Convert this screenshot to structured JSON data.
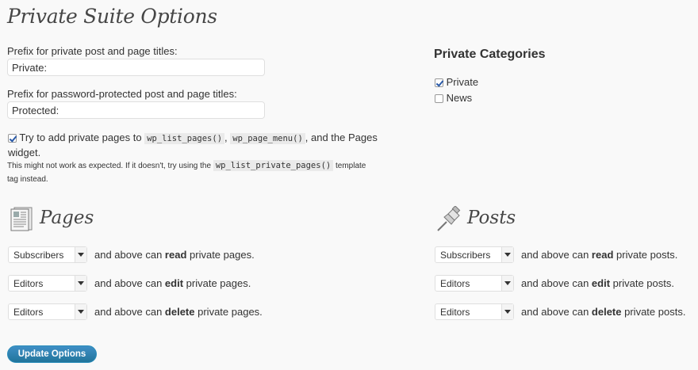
{
  "page_title": "Private Suite Options",
  "private_prefix": {
    "label": "Prefix for private post and page titles:",
    "value": "Private:"
  },
  "protected_prefix": {
    "label": "Prefix for password-protected post and page titles:",
    "value": "Protected:"
  },
  "list_pages_option": {
    "checked": true,
    "text_before": "Try to add private pages to",
    "code1": "wp_list_pages()",
    "comma": ",",
    "code2": "wp_page_menu()",
    "text_after": ", and the Pages",
    "text_line2": "widget.",
    "note_before": "This might not work as expected. If it doesn't, try using the",
    "note_code": "wp_list_private_pages()",
    "note_after": "template",
    "note_line2": "tag instead."
  },
  "private_categories": {
    "title": "Private Categories",
    "items": [
      {
        "label": "Private",
        "checked": true
      },
      {
        "label": "News",
        "checked": false
      }
    ]
  },
  "pages_section": {
    "title": "Pages",
    "rows": [
      {
        "role": "Subscribers",
        "prefix": "and above can",
        "action": "read",
        "suffix": "private pages."
      },
      {
        "role": "Editors",
        "prefix": "and above can",
        "action": "edit",
        "suffix": "private pages."
      },
      {
        "role": "Editors",
        "prefix": "and above can",
        "action": "delete",
        "suffix": "private pages."
      }
    ]
  },
  "posts_section": {
    "title": "Posts",
    "rows": [
      {
        "role": "Subscribers",
        "prefix": "and above can",
        "action": "read",
        "suffix": "private posts."
      },
      {
        "role": "Editors",
        "prefix": "and above can",
        "action": "edit",
        "suffix": "private posts."
      },
      {
        "role": "Editors",
        "prefix": "and above can",
        "action": "delete",
        "suffix": "private posts."
      }
    ]
  },
  "update_button": "Update Options",
  "colors": {
    "accent": "#21759b",
    "background": "#f9f9f9"
  }
}
